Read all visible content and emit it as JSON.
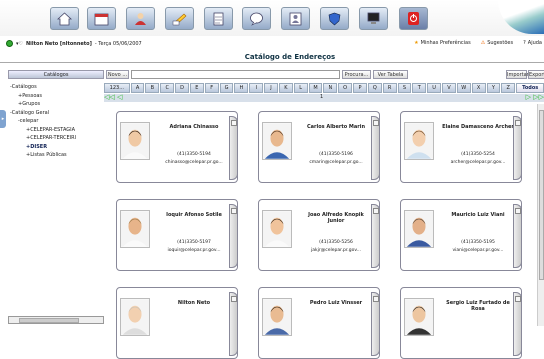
{
  "toolbar": {
    "buttons": [
      {
        "name": "home-icon"
      },
      {
        "name": "calendar-icon"
      },
      {
        "name": "contacts-icon"
      },
      {
        "name": "messages-icon"
      },
      {
        "name": "tasks-icon"
      },
      {
        "name": "chat-icon"
      },
      {
        "name": "address-book-icon"
      },
      {
        "name": "shield-icon"
      },
      {
        "name": "computer-icon"
      },
      {
        "name": "logout-icon"
      }
    ]
  },
  "user": {
    "name": "Nilton Neto [nltonneto]",
    "date": "- Terça 05/06/2007"
  },
  "links": {
    "prefs": "Minhas Preferências",
    "suggest": "Sugestões",
    "help": "Ajuda"
  },
  "page": {
    "title": "Catálogo de Endereços"
  },
  "sidebar": {
    "header": "Catálogos",
    "items": [
      "-Catálogos",
      "+Pessoas",
      "+Grupos",
      "-Catálogo Geral",
      "-celepar",
      "+CELEPAR-ESTAGIA",
      "+CELEPAR-TERCEIRI",
      "+DISER",
      "+Listas Públicas"
    ]
  },
  "search": {
    "new": "Novo ...",
    "value": "",
    "search_btn": "Procura...",
    "view_table": "Ver Tabela",
    "import": "Importar",
    "export": "Exportar"
  },
  "letters": [
    "123...",
    "A",
    "B",
    "C",
    "D",
    "E",
    "F",
    "G",
    "H",
    "I",
    "J",
    "K",
    "L",
    "M",
    "N",
    "O",
    "P",
    "Q",
    "R",
    "S",
    "T",
    "U",
    "V",
    "W",
    "X",
    "Y",
    "Z",
    "Todos"
  ],
  "pagination": {
    "current": "1"
  },
  "contacts": [
    {
      "name": "Adriana Chinasso",
      "phone": "(41)3350-5194",
      "email": "chinasso@celepar.pr.go..."
    },
    {
      "name": "Carlos Alberto Marin",
      "phone": "(41)3350-5196",
      "email": "cmarin@celepar.pr.go..."
    },
    {
      "name": "Elaine Damasceno Archer",
      "phone": "(41)3350-5254",
      "email": "archer@celepar.pr.gov..."
    },
    {
      "name": "Ioquir Afonso Sotile",
      "phone": "(41)3350-5197",
      "email": "ioquir@celepar.pr.gov..."
    },
    {
      "name": "Joao Alfredo Knopik Junior",
      "phone": "(41)3350-5256",
      "email": "jakjr@celepar.pr.gov..."
    },
    {
      "name": "Mauricio Luiz Viani",
      "phone": "(41)3350-5195",
      "email": "viani@celepar.pr.gov..."
    },
    {
      "name": "Nilton Neto",
      "phone": "",
      "email": ""
    },
    {
      "name": "Pedro Luiz Vinsser",
      "phone": "",
      "email": ""
    },
    {
      "name": "Sergio Luiz Furtado de Rosa",
      "phone": "",
      "email": ""
    }
  ],
  "colors": {
    "toolbar_button": "#94aac8",
    "title": "#134",
    "green_nav": "#3b3"
  }
}
